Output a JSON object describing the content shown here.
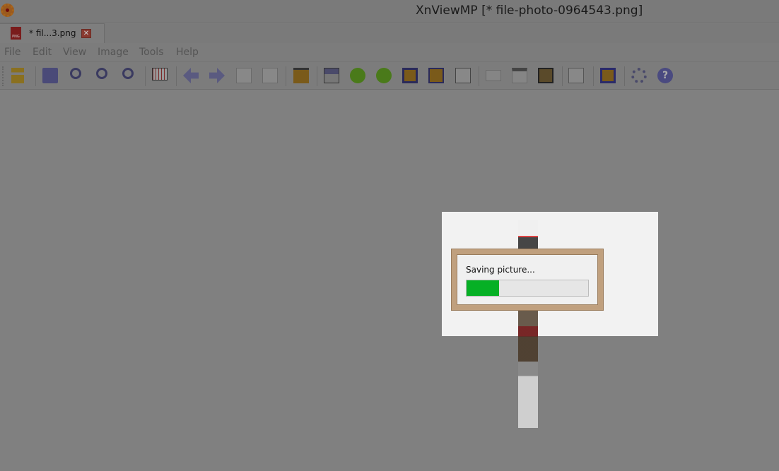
{
  "window": {
    "title": "XnViewMP [* file-photo-0964543.png]",
    "icon": "xnview-logo-icon"
  },
  "tabs": [
    {
      "label": "* fil...3.png",
      "icon": "png-file-icon",
      "close_glyph": "✕"
    }
  ],
  "menu": [
    "File",
    "Edit",
    "View",
    "Image",
    "Tools",
    "Help"
  ],
  "toolbar": [
    "browser-icon",
    "save-icon",
    "zoom-in-icon",
    "zoom-1-1-icon",
    "zoom-out-icon",
    "grid-icon",
    "previous-icon",
    "next-icon",
    "first-page-icon",
    "last-page-icon",
    "slideshow-icon",
    "adjust-icon",
    "rotate-left-icon",
    "rotate-right-icon",
    "crop-icon",
    "resize-icon",
    "copy-icon",
    "filmstrip-icon",
    "multipage-icon",
    "fullscreen-preview-icon",
    "info-icon",
    "fit-window-icon",
    "settings-icon",
    "help-icon"
  ],
  "dialog": {
    "message": "Saving picture...",
    "progress_percent": 27,
    "progress_color": "#06b025"
  }
}
